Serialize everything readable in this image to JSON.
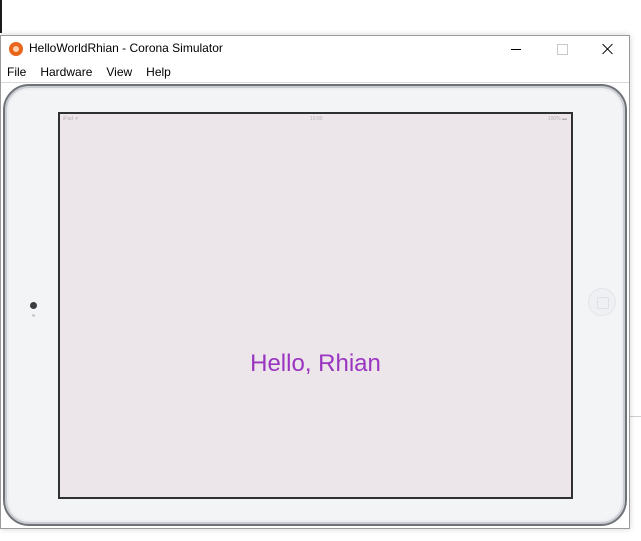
{
  "window": {
    "title": "HelloWorldRhian - Corona Simulator",
    "app_icon": "corona-icon",
    "controls": {
      "minimize_icon": "minimize-icon",
      "maximize_icon": "maximize-icon",
      "close_icon": "close-icon"
    }
  },
  "menubar": {
    "items": [
      "File",
      "Hardware",
      "View",
      "Help"
    ]
  },
  "device": {
    "statusbar": {
      "carrier": "iPad ᯤ",
      "time": "10:00",
      "battery": "100% ▬"
    },
    "content": {
      "label": "Hello, Rhian",
      "label_color": "#9a35c1",
      "background_color": "#ece5ea"
    }
  }
}
